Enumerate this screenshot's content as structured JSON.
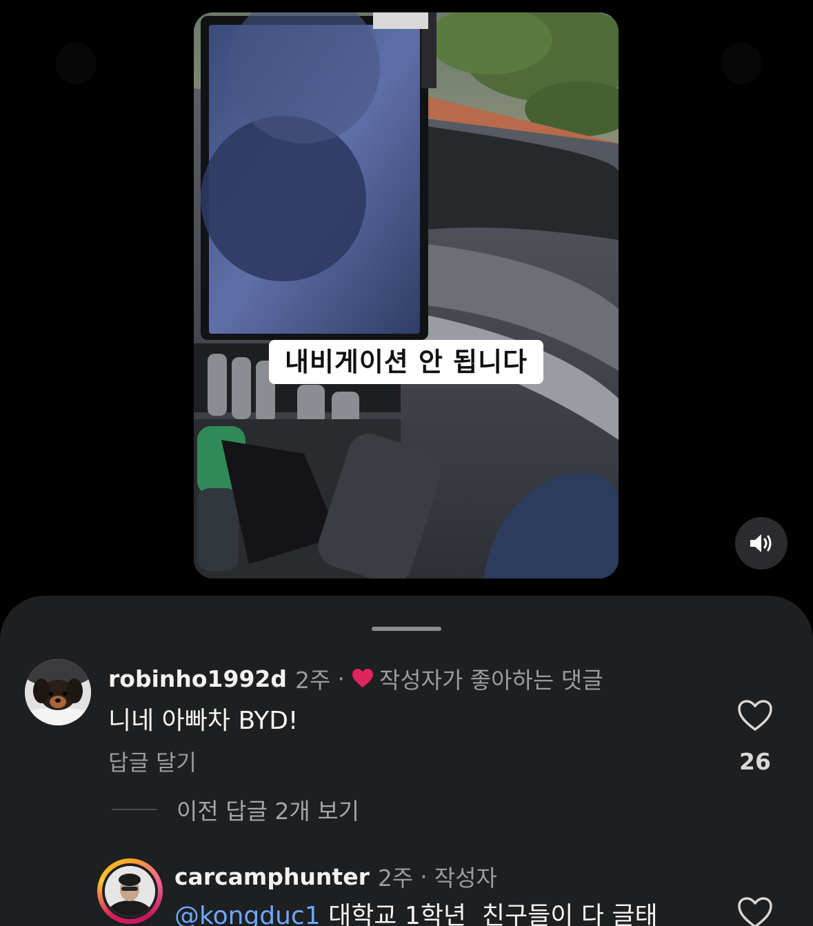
{
  "video": {
    "caption": "내비게이션 안 됩니다",
    "sound_icon": "speaker-icon"
  },
  "comments": [
    {
      "username": "robinho1992d",
      "time": "2주",
      "separator": "·",
      "liked_label": "작성자가 좋아하는 댓글",
      "text": "니네 아빠차 BYD!",
      "reply_label": "답글 달기",
      "like_count": "26"
    }
  ],
  "view_replies_label": "이전 답글 2개 보기",
  "reply": {
    "username": "carcamphunter",
    "time": "2주",
    "separator": "·",
    "author_badge": "작성자",
    "mention": "@kongduc1",
    "text": " 대학교 1학년  친구들이 다 글태"
  },
  "colors": {
    "sheet_bg": "#1d1f21",
    "heart_red": "#e0245e",
    "mention_blue": "#6ea8fe"
  }
}
